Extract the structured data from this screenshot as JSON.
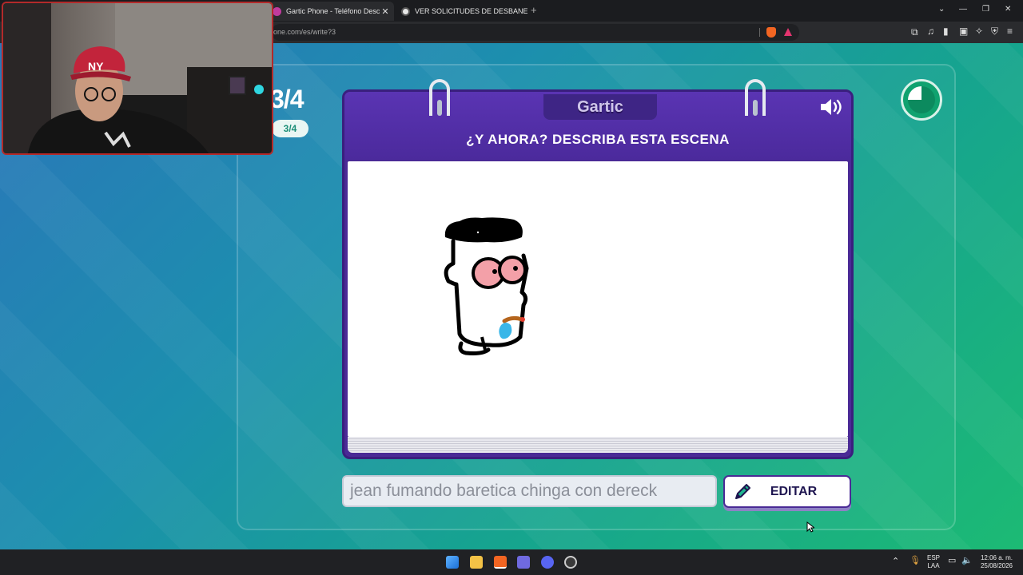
{
  "browser": {
    "tabs": [
      {
        "title": "Gartic Phone - Teléfono Descom",
        "active": true,
        "fav_color": "#c03b9e"
      },
      {
        "title": "VER SOLICITUDES DE DESBANEO EN",
        "active": false,
        "fav_color": "#e8e8e8"
      }
    ],
    "url": "one.com/es/write?3"
  },
  "game": {
    "round_big": "3/4",
    "round_pill": "3/4",
    "logo": "Gartic",
    "prompt": "¿Y AHORA? DESCRIBA ESTA ESCENA",
    "answer_value": "jean fumando baretica chinga con dereck",
    "edit_label": "EDITAR",
    "timer_fraction_elapsed": 0.25,
    "colors": {
      "card": "#4a2a96",
      "accent": "#10a26f"
    }
  },
  "taskbar": {
    "lang_top": "ESP",
    "lang_bottom": "LAA",
    "time": "12:06 a. m.",
    "date": "25/08/2026"
  }
}
